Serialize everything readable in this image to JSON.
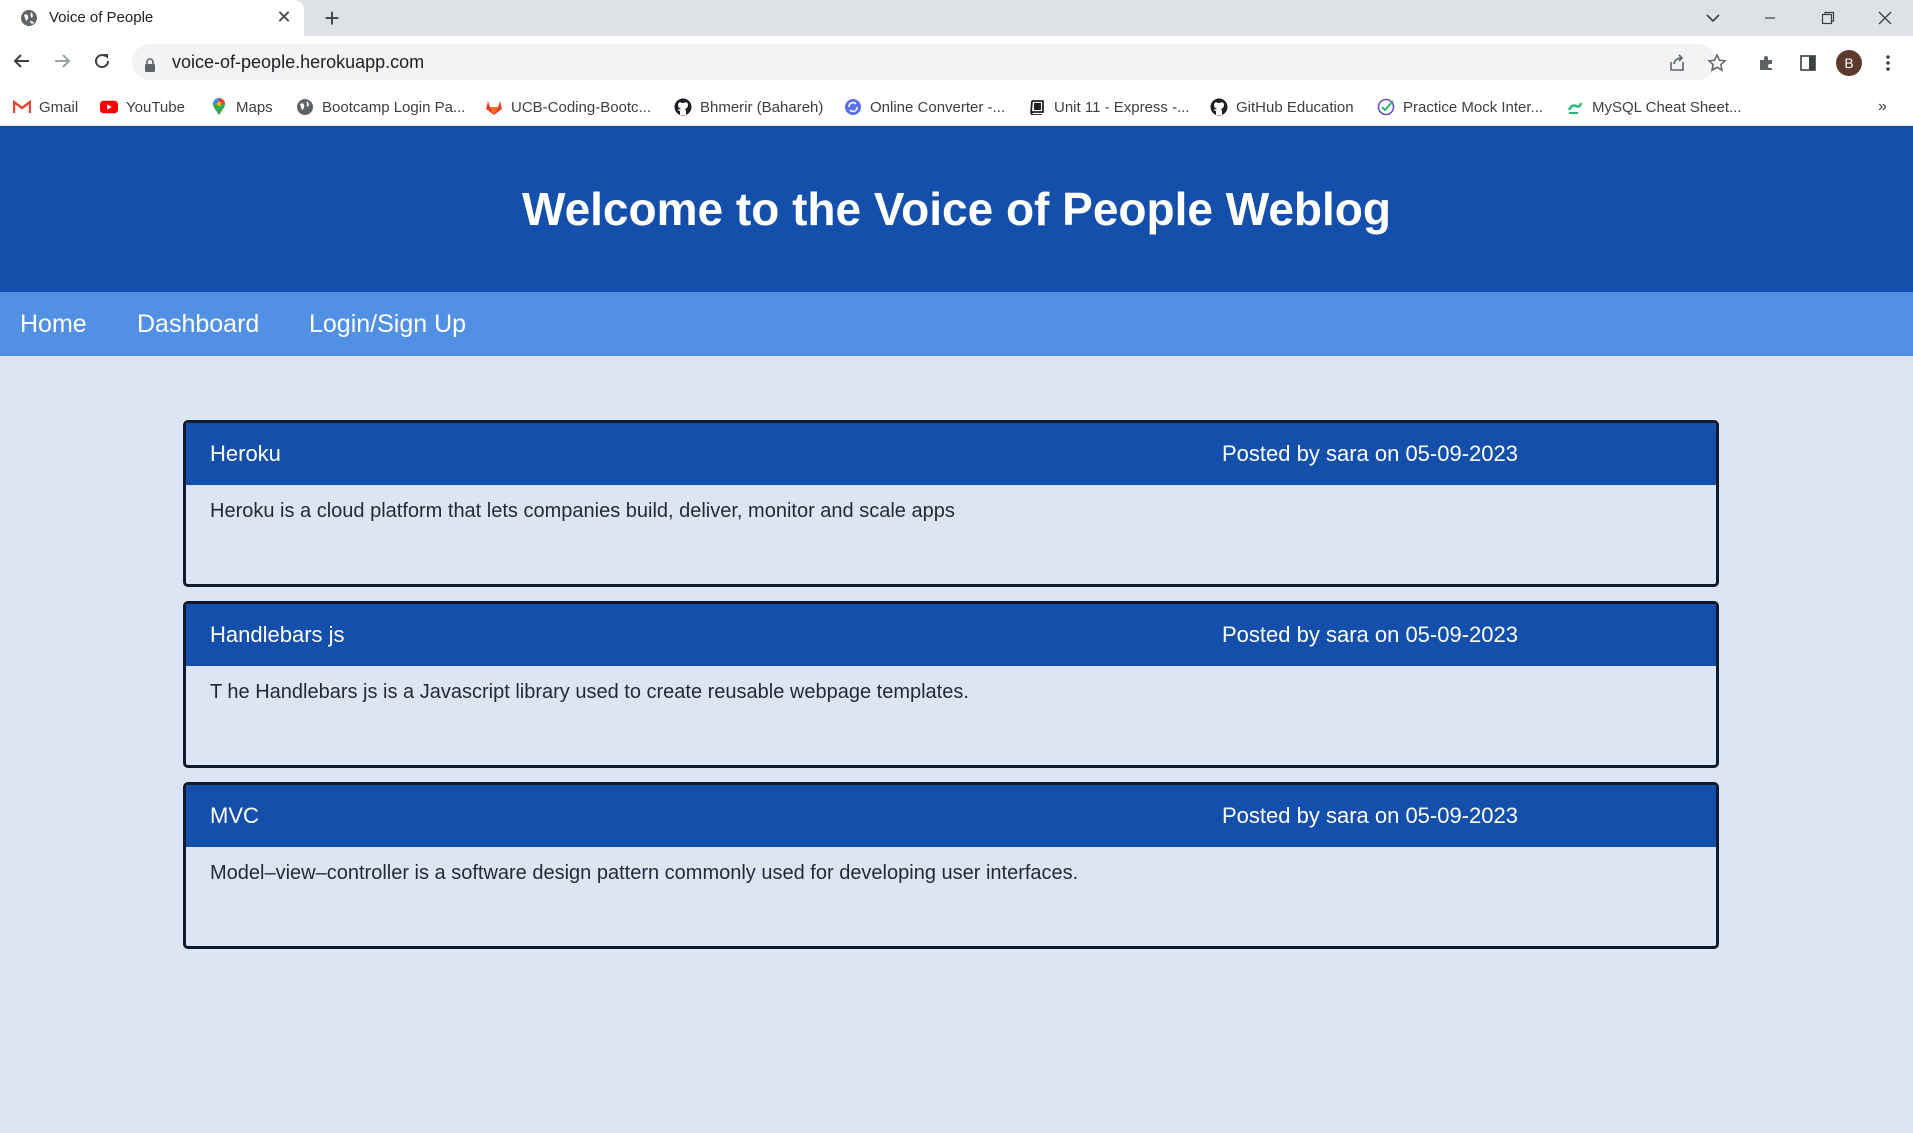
{
  "browser": {
    "tab_title": "Voice of People",
    "url": "voice-of-people.herokuapp.com",
    "profile_initial": "B",
    "bookmarks": [
      {
        "label": "Gmail",
        "icon": "gmail-icon"
      },
      {
        "label": "YouTube",
        "icon": "youtube-icon"
      },
      {
        "label": "Maps",
        "icon": "maps-icon"
      },
      {
        "label": "Bootcamp Login Pa...",
        "icon": "globe-icon"
      },
      {
        "label": "UCB-Coding-Bootc...",
        "icon": "gitlab-icon"
      },
      {
        "label": "Bhmerir (Bahareh)",
        "icon": "github-icon"
      },
      {
        "label": "Online Converter -...",
        "icon": "converter-icon"
      },
      {
        "label": "Unit 11 - Express -...",
        "icon": "book-icon"
      },
      {
        "label": "GitHub Education",
        "icon": "github-icon"
      },
      {
        "label": "Practice Mock Inter...",
        "icon": "check-circle-icon"
      },
      {
        "label": "MySQL Cheat Sheet...",
        "icon": "mysql-icon"
      }
    ],
    "bookmarks_overflow": "»"
  },
  "site": {
    "title": "Welcome to the Voice of People Weblog",
    "nav": [
      "Home",
      "Dashboard",
      "Login/Sign Up"
    ]
  },
  "posts": [
    {
      "title": "Heroku",
      "meta": "Posted by sara on 05-09-2023",
      "body": "Heroku is a cloud platform that lets companies build, deliver, monitor and scale apps"
    },
    {
      "title": "Handlebars js",
      "meta": "Posted by sara on 05-09-2023",
      "body": "T he Handlebars js is a Javascript library used to create reusable webpage templates."
    },
    {
      "title": "MVC",
      "meta": "Posted by sara on 05-09-2023",
      "body": "Model–view–controller is a software design pattern commonly used for developing user interfaces."
    }
  ],
  "colors": {
    "header": "#1450ab",
    "nav": "#5190e3",
    "page_bg": "#dce5f4"
  }
}
